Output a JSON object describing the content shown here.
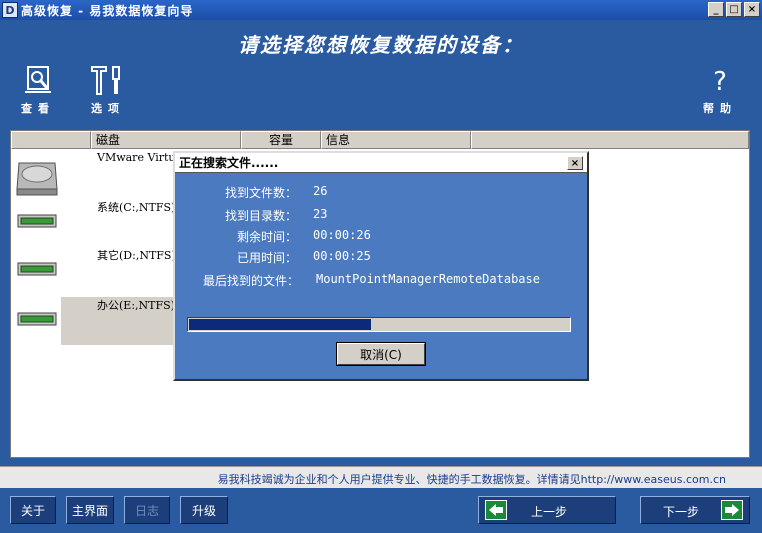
{
  "window": {
    "app_icon_letter": "D",
    "title": "高级恢复 - 易我数据恢复向导",
    "min": "_",
    "max": "□",
    "close": "×"
  },
  "header": {
    "subtitle": "请选择您想恢复数据的设备：",
    "tools": [
      {
        "label": "查看",
        "icon": "view-disk-icon"
      },
      {
        "label": "选项",
        "icon": "tools-icon"
      },
      {
        "label": "帮助",
        "icon": "help-icon"
      }
    ]
  },
  "list": {
    "columns": [
      "磁盘",
      "容量",
      "信息"
    ],
    "rows": [
      {
        "name": "VMware Virtua",
        "icon": "hard-disk-icon"
      },
      {
        "name": "系统(C:,NTFS)",
        "icon": "partition-icon"
      },
      {
        "name": "其它(D:,NTFS)",
        "icon": "partition-icon"
      },
      {
        "name": "办公(E:,NTFS)",
        "icon": "partition-icon",
        "selected": true
      }
    ]
  },
  "dialog": {
    "title": "正在搜索文件......",
    "close": "×",
    "fields": [
      {
        "label": "找到文件数：",
        "value": "26"
      },
      {
        "label": "找到目录数：",
        "value": "23"
      },
      {
        "label": "剩余时间：",
        "value": "00:00:26"
      },
      {
        "label": "已用时间：",
        "value": "00:00:25"
      },
      {
        "label": "最后找到的文件：",
        "value": "MountPointManagerRemoteDatabase"
      }
    ],
    "progress_fraction": 0.48,
    "cancel": "取消(C)"
  },
  "info": {
    "text": "易我科技竭诚为企业和个人用户提供专业、快捷的手工数据恢复。详情请见http://www.easeus.com.cn"
  },
  "bottom": {
    "about": "关于",
    "main": "主界面",
    "log": "日志",
    "upgrade": "升级",
    "prev": "上一步",
    "next": "下一步"
  },
  "colors": {
    "background": "#2a5aa0",
    "dialog": "#4b7ac0",
    "progress": "#0c2a7a",
    "arrow_green": "#1a8a3a"
  }
}
